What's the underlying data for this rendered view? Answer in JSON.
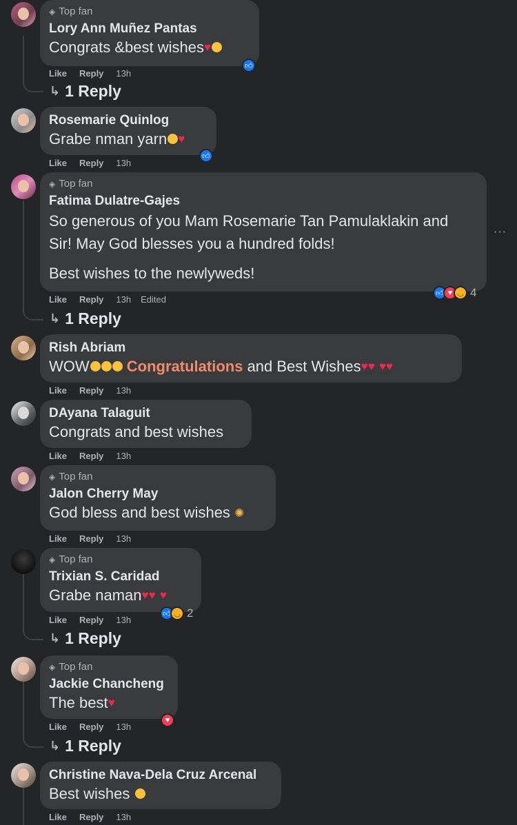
{
  "comments": [
    {
      "badge": "Top fan",
      "author": "Lory Ann Muñez Pantas",
      "text": "Congrats &best wishes",
      "like": "Like",
      "reply": "Reply",
      "time": "13h",
      "replies": "1 Reply"
    },
    {
      "author": "Rosemarie Quinlog",
      "text": "Grabe nman yarn",
      "like": "Like",
      "reply": "Reply",
      "time": "13h"
    },
    {
      "badge": "Top fan",
      "author": "Fatima Dulatre-Gajes",
      "text": "So generous of you Mam Rosemarie Tan Pamulaklakin and Sir! May God blesses you a hundred folds!",
      "text2": "Best wishes to the newlyweds!",
      "like": "Like",
      "reply": "Reply",
      "time": "13h",
      "edited": "Edited",
      "reaction_count": "4",
      "replies": "1 Reply"
    },
    {
      "author": "Rish Abriam",
      "text_a": "WOW",
      "text_hl": "Congratulations",
      "text_b": " and Best Wishes",
      "like": "Like",
      "reply": "Reply",
      "time": "13h"
    },
    {
      "author": "DAyana Talaguit",
      "text": "Congrats and best wishes",
      "like": "Like",
      "reply": "Reply",
      "time": "13h"
    },
    {
      "badge": "Top fan",
      "author": "Jalon Cherry May",
      "text": "God bless and best wishes",
      "like": "Like",
      "reply": "Reply",
      "time": "13h"
    },
    {
      "badge": "Top fan",
      "author": "Trixian S. Caridad",
      "text": "Grabe naman",
      "like": "Like",
      "reply": "Reply",
      "time": "13h",
      "reaction_count": "2",
      "replies": "1 Reply"
    },
    {
      "badge": "Top fan",
      "author": "Jackie Chancheng",
      "text": "The best",
      "like": "Like",
      "reply": "Reply",
      "time": "13h",
      "replies": "1 Reply"
    },
    {
      "author": "Christine Nava-Dela Cruz Arcenal",
      "text": "Best wishes",
      "like": "Like",
      "reply": "Reply",
      "time": "13h"
    }
  ],
  "more_options": "···",
  "icons": {
    "badge": "diamond-icon",
    "reply_arrow": "reply-arrow-icon",
    "reactions": [
      "like-icon",
      "love-icon",
      "haha-icon",
      "wow-icon"
    ]
  },
  "colors": {
    "background": "#242527",
    "bubble": "#3a3b3c",
    "like_reaction": "#1877f2",
    "love_reaction": "#f33e58",
    "highlight_text": "#f08b6e"
  }
}
